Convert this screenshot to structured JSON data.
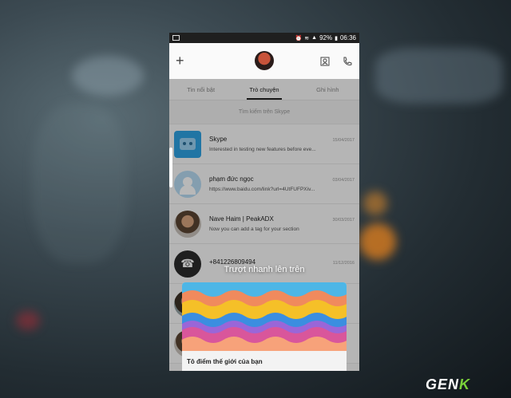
{
  "statusbar": {
    "battery": "92%",
    "time": "06:36",
    "icons": [
      "image-icon",
      "alarm-icon",
      "wifi-icon",
      "signal-icon",
      "battery-icon"
    ]
  },
  "header": {
    "add_icon": "plus-icon",
    "right_icons": [
      "contacts-icon",
      "call-icon"
    ]
  },
  "tabs": [
    {
      "label": "Tin nổi bật"
    },
    {
      "label": "Trò chuyện",
      "active": true
    },
    {
      "label": "Ghi hình"
    }
  ],
  "search": {
    "label": "Tìm kiếm trên Skype"
  },
  "conversations": [
    {
      "name": "Skype",
      "date": "15/04/2017",
      "message": "Interested in testing new features before eve..."
    },
    {
      "name": "phạm đức ngọc",
      "date": "03/04/2017",
      "message": "https://www.baidu.com/link?url=4UtFUFPXiv..."
    },
    {
      "name": "Nave Haim | PeakADX",
      "date": "30/03/2017",
      "message": "Now you can add a tag for your section"
    },
    {
      "name": "+841226809494",
      "date": "11/12/2016",
      "message": ""
    },
    {
      "name": "",
      "date": "",
      "message": ""
    },
    {
      "name": "",
      "date": "",
      "message": ""
    }
  ],
  "hint": {
    "text": "Trượt nhanh lên trên"
  },
  "card": {
    "title": "Tô điểm thế giới của bạn",
    "subtitle": ""
  },
  "watermark": {
    "text": "GEN",
    "accent": "K"
  },
  "colors": {
    "wave1": "#4db6e6",
    "wave2": "#f08a5d",
    "wave3": "#f5c028",
    "wave4": "#3b8ee0",
    "wave5": "#d9569b",
    "wave6": "#f7a27a",
    "watermark_accent": "#7ad13a"
  }
}
